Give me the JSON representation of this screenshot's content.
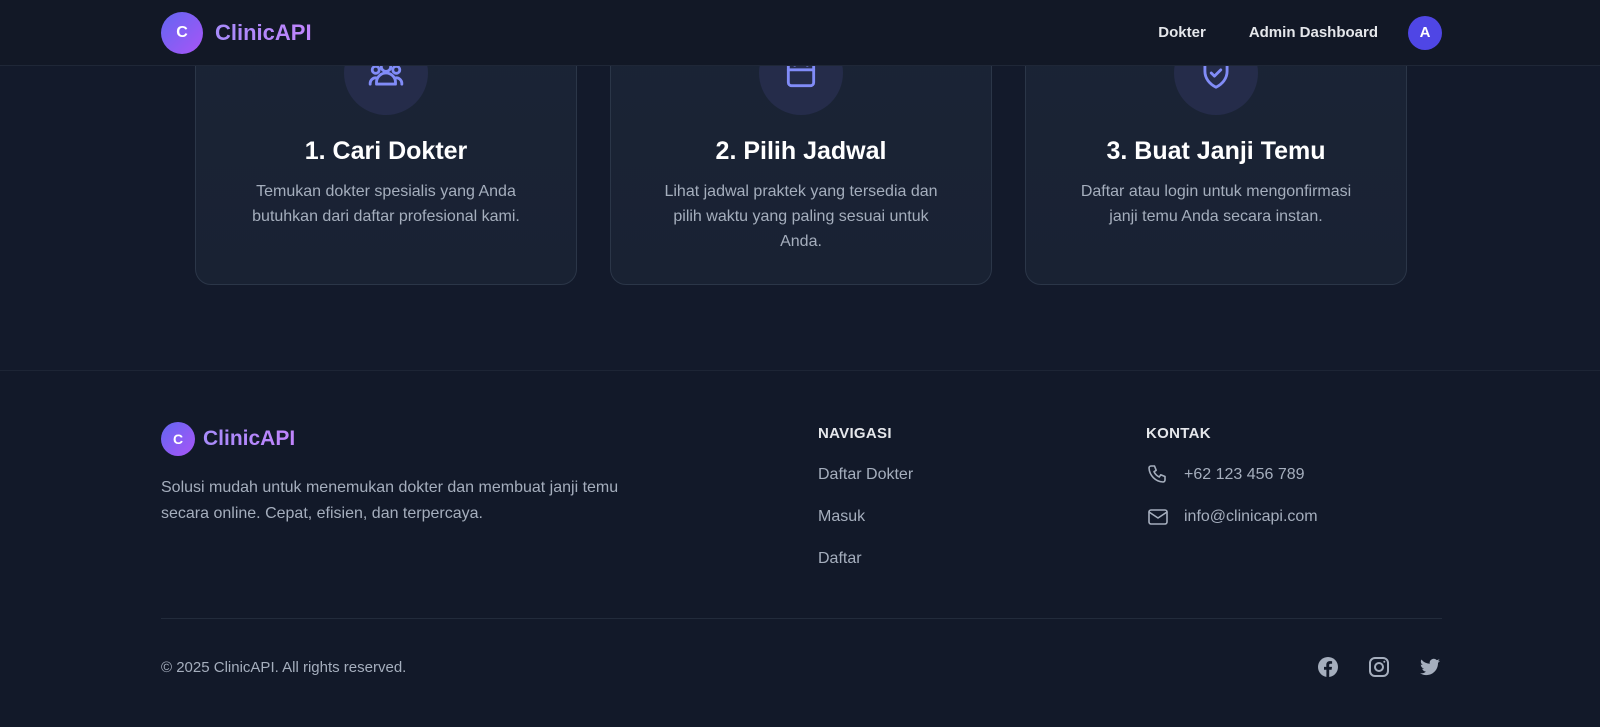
{
  "navbar": {
    "logo_letter": "C",
    "brand": "ClinicAPI",
    "links": [
      "Dokter",
      "Admin Dashboard"
    ],
    "avatar_letter": "A"
  },
  "steps": [
    {
      "icon": "users-icon",
      "title": "1. Cari Dokter",
      "description": "Temukan dokter spesialis yang Anda butuhkan dari daftar profesional kami."
    },
    {
      "icon": "calendar-icon",
      "title": "2. Pilih Jadwal",
      "description": "Lihat jadwal praktek yang tersedia dan pilih waktu yang paling sesuai untuk Anda."
    },
    {
      "icon": "check-badge-icon",
      "title": "3. Buat Janji Temu",
      "description": "Daftar atau login untuk mengonfirmasi janji temu Anda secara instan."
    }
  ],
  "footer": {
    "logo_letter": "C",
    "brand": "ClinicAPI",
    "description": "Solusi mudah untuk menemukan dokter dan membuat janji temu secara online. Cepat, efisien, dan terpercaya.",
    "navigation": {
      "heading": "NAVIGASI",
      "links": [
        "Daftar Dokter",
        "Masuk",
        "Daftar"
      ]
    },
    "contact": {
      "heading": "KONTAK",
      "phone": "+62 123 456 789",
      "email": "info@clinicapi.com"
    },
    "copyright": "© 2025 ClinicAPI. All rights reserved.",
    "socials": [
      "facebook-icon",
      "instagram-icon",
      "twitter-icon"
    ]
  },
  "colors": {
    "background": "#141a2a",
    "card": "#1b2436",
    "accent": "#818cf8",
    "brand_gradient_start": "#6366f1",
    "brand_gradient_end": "#a855f7",
    "muted_text": "#a5aebd"
  }
}
